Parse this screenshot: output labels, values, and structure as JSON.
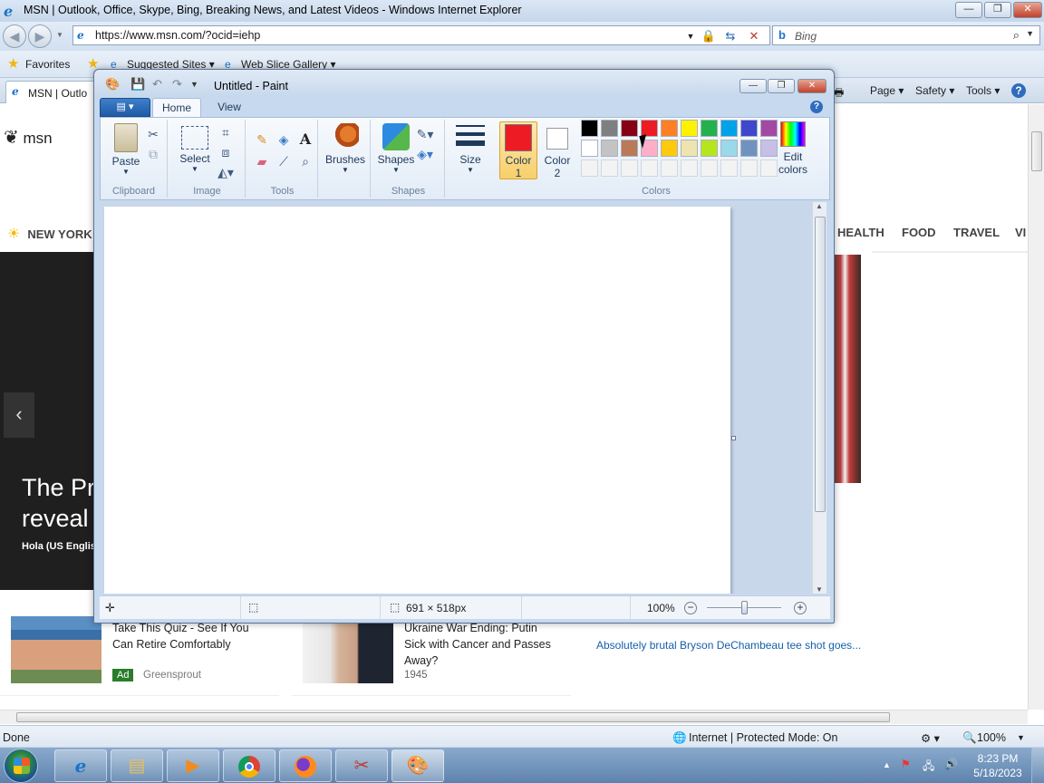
{
  "ie": {
    "title": "MSN | Outlook, Office, Skype, Bing, Breaking News, and Latest Videos - Windows Internet Explorer",
    "url": "https://www.msn.com/?ocid=iehp",
    "search_placeholder": "Bing",
    "favorites_label": "Favorites",
    "suggested_sites": "Suggested Sites",
    "web_slice_gallery": "Web Slice Gallery",
    "tab_label": "MSN | Outlo",
    "commands": {
      "page": "Page",
      "safety": "Safety",
      "tools": "Tools"
    },
    "status": {
      "left": "Done",
      "zone": "Internet | Protected Mode: On",
      "zoom": "100%"
    }
  },
  "msn": {
    "logo": "msn",
    "weather_label": "NEW YORK",
    "nav": [
      "HEALTH",
      "FOOD",
      "TRAVEL",
      "VI"
    ],
    "hero": {
      "headline": "The Pr\nreveal",
      "source": "Hola (US Englis"
    },
    "cards": [
      {
        "title": "Take This Quiz - See If You Can Retire Comfortably",
        "ad": "Ad",
        "sponsor": "Greensprout"
      },
      {
        "title": "Ukraine War Ending: Putin Sick with Cancer and Passes Away?",
        "sponsor": "1945"
      }
    ],
    "links": [
      "Absolutely brutal Bryson DeChambeau tee shot goes..."
    ]
  },
  "paint": {
    "title": "Untitled - Paint",
    "tabs": {
      "home": "Home",
      "view": "View"
    },
    "groups": {
      "clipboard": "Clipboard",
      "image": "Image",
      "tools": "Tools",
      "shapes": "Shapes",
      "colors": "Colors"
    },
    "buttons": {
      "paste": "Paste",
      "select": "Select",
      "brushes": "Brushes",
      "shapes": "Shapes",
      "size": "Size",
      "color1_a": "Color",
      "color1_b": "1",
      "color2_a": "Color",
      "color2_b": "2",
      "edit_a": "Edit",
      "edit_b": "colors"
    },
    "color1": "#ed1c24",
    "color2": "#ffffff",
    "palette_row1": [
      "#000000",
      "#7f7f7f",
      "#880015",
      "#ed1c24",
      "#ff7f27",
      "#fff200",
      "#22b14c",
      "#00a2e8",
      "#3f48cc",
      "#a349a4"
    ],
    "palette_row2": [
      "#ffffff",
      "#c3c3c3",
      "#b97a57",
      "#ffaec9",
      "#ffc90e",
      "#efe4b0",
      "#b5e61d",
      "#99d9ea",
      "#7092be",
      "#c8bfe7"
    ],
    "status": {
      "size": "691 × 518px",
      "zoom": "100%"
    }
  },
  "taskbar": {
    "clock_time": "8:23 PM",
    "clock_date": "5/18/2023"
  }
}
